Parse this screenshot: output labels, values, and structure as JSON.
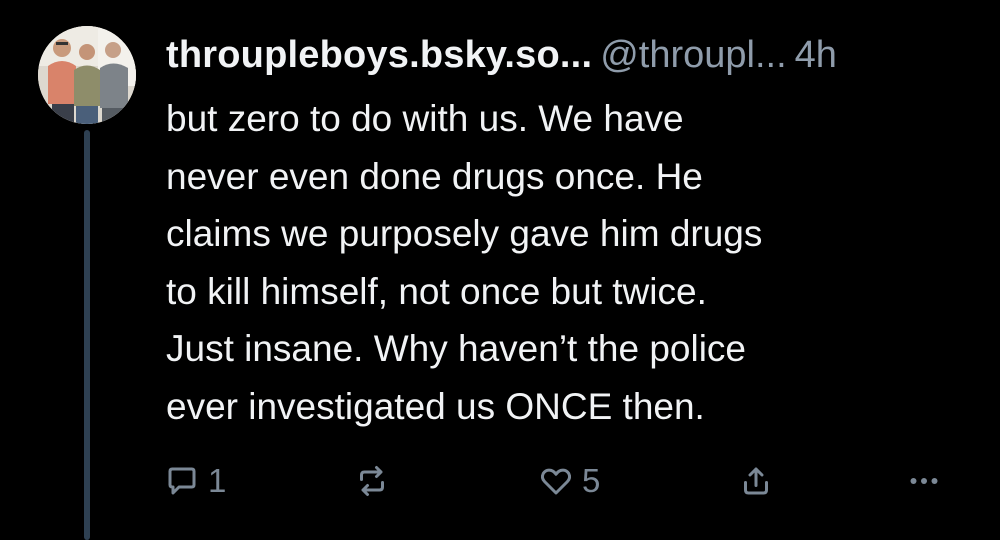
{
  "post": {
    "display_name": "throupleboys.bsky.so...",
    "handle": "@throupl...",
    "time": "4h",
    "text_lines": [
      "but zero to do with us. We have",
      "never even done drugs once. He",
      "claims we purposely gave him drugs",
      "to kill himself, not once but twice.",
      "Just insane. Why haven’t the police",
      "ever investigated us ONCE then."
    ]
  },
  "actions": {
    "reply_count": "1",
    "repost_icon": "repost-icon",
    "like_count": "5",
    "share_icon": "share-icon",
    "more_icon": "more-icon"
  },
  "colors": {
    "background": "#000000",
    "text": "#f1f3f5",
    "muted": "#8f9cab",
    "thread_line": "#2e4052"
  }
}
